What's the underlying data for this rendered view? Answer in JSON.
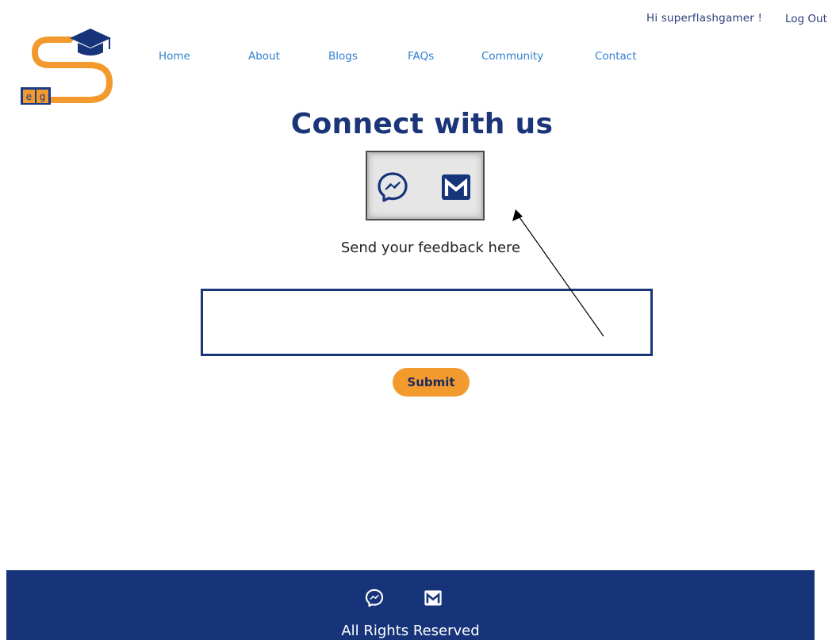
{
  "user_bar": {
    "greeting": "Hi superflashgamer !",
    "logout_label": "Log Out"
  },
  "logo": {
    "book_letters": "e|g"
  },
  "nav": {
    "items": [
      {
        "label": "Home"
      },
      {
        "label": "About"
      },
      {
        "label": "Blogs"
      },
      {
        "label": "FAQs"
      },
      {
        "label": "Community"
      },
      {
        "label": "Contact"
      }
    ]
  },
  "main": {
    "heading": "Connect with us",
    "social_icons": [
      "messenger-icon",
      "gmail-icon"
    ],
    "feedback_label": "Send your feedback here",
    "feedback_value": "",
    "submit_label": "Submit"
  },
  "footer": {
    "social_icons": [
      "messenger-icon",
      "gmail-icon"
    ],
    "text": "All Rights Reserved"
  },
  "colors": {
    "brand_navy": "#17347a",
    "accent_orange": "#f29a2e",
    "nav_link": "#2f80d0"
  }
}
